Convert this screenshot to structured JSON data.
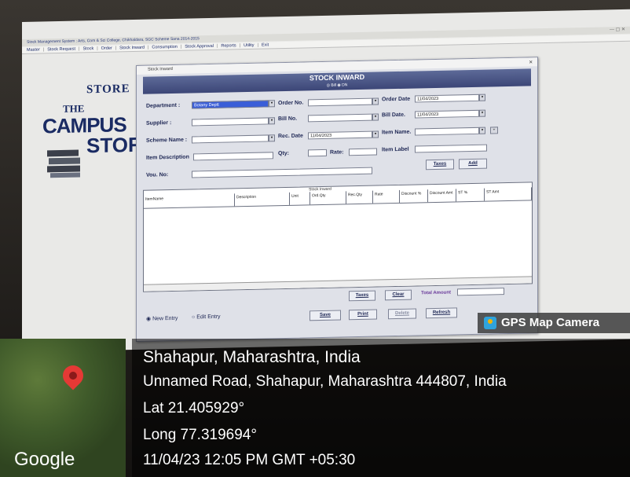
{
  "app": {
    "titlebar": "Stock Management System : Arts, Com & Sci College, Chikhaldara, SGC Scheme Sana 2014-2015",
    "menu": [
      "Master",
      "Stock Request",
      "Stock",
      "Order",
      "Stock Inward",
      "Consumption",
      "Stock Approval",
      "Reports",
      "Utility",
      "Exit"
    ]
  },
  "logo": {
    "store": "STORE",
    "the": "THE",
    "campus": "CAMPUS",
    "stor": "STOR"
  },
  "dialog": {
    "window_title": "Stock Inward",
    "heading": "STOCK INWARD",
    "options": "◎ Bill  ◉ DN",
    "fields": {
      "department_label": "Department :",
      "department_value": "Botany Deptt",
      "order_no_label": "Order No.",
      "order_no_value": "",
      "order_date_label": "Order Date",
      "order_date_value": "11/04/2023",
      "supplier_label": "Supplier :",
      "supplier_value": "",
      "bill_no_label": "Bill No.",
      "bill_no_value": "",
      "bill_date_label": "Bill Date.",
      "bill_date_value": "11/04/2023",
      "scheme_label": "Scheme Name :",
      "scheme_value": "",
      "rec_date_label": "Rec. Date",
      "rec_date_value": "11/04/2023",
      "item_name_label": "Item Name.",
      "item_name_value": "",
      "item_desc_label": "Item Description",
      "item_desc_value": "",
      "qty_label": "Qty:",
      "qty_value": "",
      "rate_label": "Rate:",
      "rate_value": "",
      "item_label_label": "Item Label",
      "item_label_value": "",
      "vou_no_label": "Vou. No:",
      "vou_no_value": ""
    },
    "buttons_top": {
      "taxes": "Taxes",
      "add": "Add"
    },
    "grid": {
      "caption": "Stock Inward",
      "columns": [
        "ItemName",
        "Description",
        "Unit",
        "Ord.Qty",
        "Rec.Qty",
        "Rate",
        "Discount %",
        "Discount Amt",
        "ST %",
        "ST Amt"
      ]
    },
    "buttons_bottom": {
      "taxes": "Taxes",
      "clear": "Clear",
      "total_label": "Total Amount",
      "total_value": ""
    },
    "mode": {
      "new": "New Entry",
      "edit": "Edit Entry"
    },
    "actions": {
      "save": "Save",
      "print": "Print",
      "delete": "Delete",
      "refresh": "Refresh"
    }
  },
  "overlay": {
    "badge": "GPS Map Camera",
    "place": "Shahapur, Maharashtra, India",
    "address": "Unnamed Road, Shahapur, Maharashtra 444807, India",
    "lat": "Lat 21.405929°",
    "long": "Long 77.319694°",
    "datetime": "11/04/23 12:05 PM GMT +05:30",
    "map_brand": "Google"
  }
}
